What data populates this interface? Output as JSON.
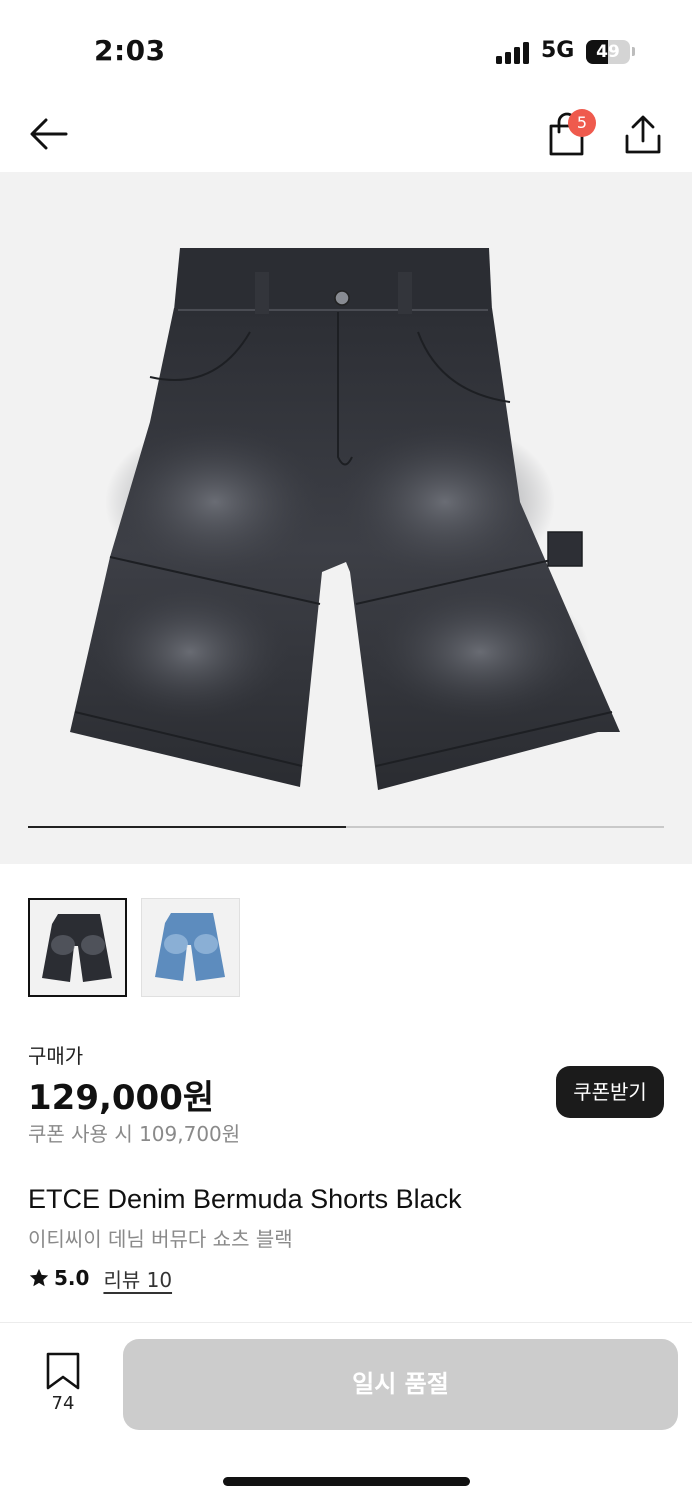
{
  "status_bar": {
    "time": "2:03",
    "network": "5G",
    "battery_level": "49",
    "battery_fraction": 0.49
  },
  "nav": {
    "back_icon": "arrow-left-icon",
    "cart_icon": "shopping-bag-icon",
    "cart_badge": "5",
    "share_icon": "share-upload-icon",
    "badge_color": "#ef5a4d"
  },
  "gallery": {
    "progress_fraction": 0.5,
    "thumbnails": [
      {
        "name": "black",
        "color": "#2b2d33",
        "selected": true
      },
      {
        "name": "blue",
        "color": "#6f98c3",
        "selected": false
      }
    ]
  },
  "price": {
    "label": "구매가",
    "amount": "129,000원",
    "coupon_price": "쿠폰 사용 시 109,700원",
    "coupon_button": "쿠폰받기"
  },
  "product": {
    "title_en": "ETCE Denim Bermuda Shorts Black",
    "title_ko": "이티씨이 데님 버뮤다 쇼츠 블랙",
    "rating": "5.0",
    "reviews": "리뷰 10"
  },
  "bottom_bar": {
    "bookmark_icon": "bookmark-icon",
    "bookmark_count": "74",
    "action_label": "일시 품절",
    "action_color": "#cccccc"
  }
}
